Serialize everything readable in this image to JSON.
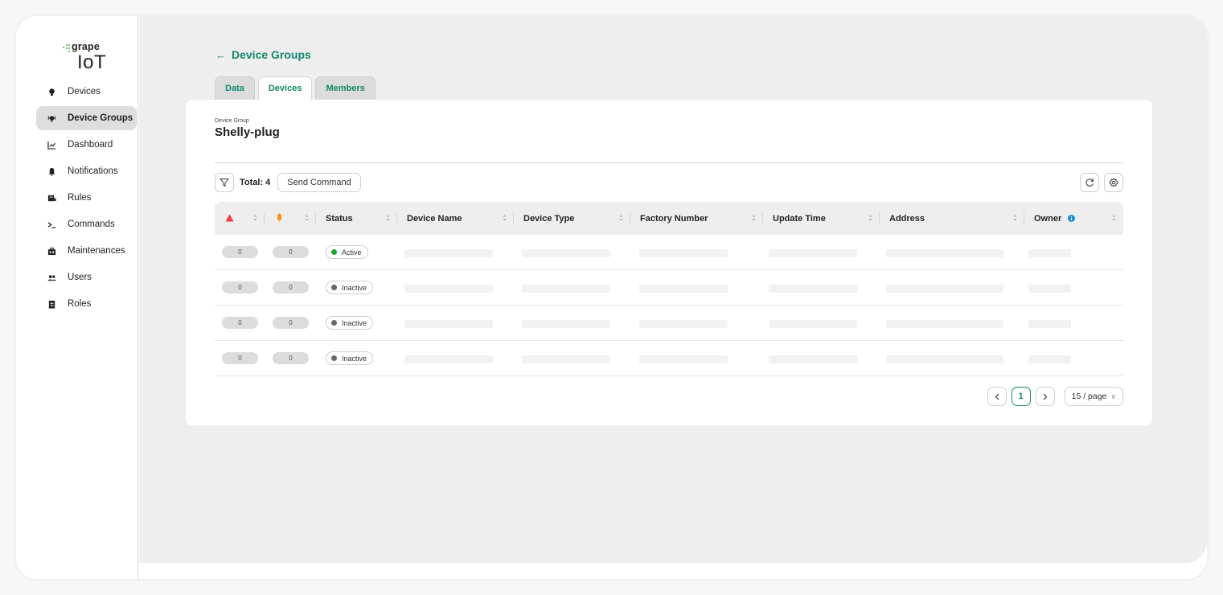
{
  "app": {
    "logo_small": "grape",
    "logo_big": "IoT",
    "brand_color": "#13896b"
  },
  "sidebar": {
    "items": [
      {
        "label": "Devices",
        "icon": "lightbulb-icon"
      },
      {
        "label": "Device Groups",
        "icon": "device-groups-icon",
        "active": true
      },
      {
        "label": "Dashboard",
        "icon": "chart-icon"
      },
      {
        "label": "Notifications",
        "icon": "bell-icon"
      },
      {
        "label": "Rules",
        "icon": "rules-icon"
      },
      {
        "label": "Commands",
        "icon": "terminal-icon"
      },
      {
        "label": "Maintenances",
        "icon": "toolbox-icon"
      },
      {
        "label": "Users",
        "icon": "users-icon"
      },
      {
        "label": "Roles",
        "icon": "roles-icon"
      }
    ]
  },
  "header": {
    "back_label": "Device Groups",
    "tabs": [
      {
        "label": "Data"
      },
      {
        "label": "Devices",
        "active": true
      },
      {
        "label": "Members"
      }
    ]
  },
  "group": {
    "caption": "Device Group",
    "name": "Shelly-plug"
  },
  "toolbar": {
    "total_label": "Total: 4",
    "send_command_label": "Send Command"
  },
  "table": {
    "columns": [
      "Status",
      "Device Name",
      "Device Type",
      "Factory Number",
      "Update Time",
      "Address",
      "Owner"
    ],
    "rows": [
      {
        "alarm": "0",
        "warning": "0",
        "status": "Active",
        "status_color": "#1fa32e"
      },
      {
        "alarm": "0",
        "warning": "0",
        "status": "Inactive",
        "status_color": "#666666"
      },
      {
        "alarm": "0",
        "warning": "0",
        "status": "Inactive",
        "status_color": "#666666"
      },
      {
        "alarm": "0",
        "warning": "0",
        "status": "Inactive",
        "status_color": "#666666"
      }
    ]
  },
  "pagination": {
    "current_page": "1",
    "page_size_label": "15 / page"
  }
}
